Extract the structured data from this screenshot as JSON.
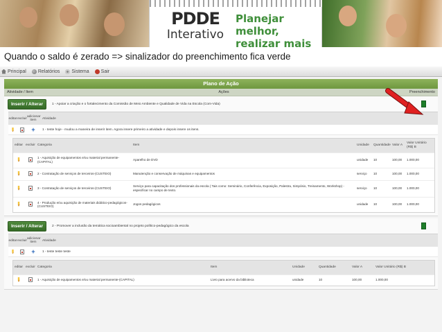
{
  "banner": {
    "logo_title": "PDDE",
    "logo_subtitle": "Interativo",
    "tagline_line1": "Planejar melhor,",
    "tagline_line2": "realizar mais"
  },
  "caption": "Quando o saldo é zerado => sinalizador do preenchimento fica verde",
  "menu": [
    {
      "label": "Principal",
      "icon": "home-icon"
    },
    {
      "label": "Relatórios",
      "icon": "reports-icon"
    },
    {
      "label": "Sistema",
      "icon": "system-icon"
    },
    {
      "label": "Sair",
      "icon": "exit-icon"
    }
  ],
  "plan": {
    "title": "Plano de Ação",
    "columns": {
      "item": "Atividade / Item",
      "actions": "Ações",
      "fill": "Preenchimento"
    },
    "indicator_color": "#1e7e2a",
    "insert_label": "Inserir / Alterar",
    "activity_headers": {
      "edit": "editar",
      "delete": "excluir",
      "add": "adicionar item",
      "activity": "Atividade"
    },
    "item_headers": {
      "edit": "editar",
      "delete": "excluir",
      "category": "Categoria",
      "item": "Item",
      "unit": "Unidade",
      "qty": "Quantidade",
      "value": "Valor A",
      "unit_value": "Valor Unitário (R$) B"
    },
    "actions": [
      {
        "text": "1 - Apoiar a criação e o fortalecimento da Comissão de Meio Ambiente e Qualidade de Vida na Escola (Com-Vida)",
        "activity": "1 - teste hoje - mudou a maneira de inserir item. Agora insere primeiro a atividade e depois insere os itens.",
        "items": [
          {
            "category": "1 - Aquisição de equipamentos e/ou material permanente-(CAPITAL)",
            "item": "Aparelho de DVD",
            "unit": "unidade",
            "qty": "10",
            "value": "100,00",
            "unit_value": "1.000,00"
          },
          {
            "category": "2 - Contratação de serviços de terceiros-(CUSTEIO)",
            "item": "Manutenção e conservação de máquinas e equipamentos",
            "unit": "serviço",
            "qty": "10",
            "value": "100,00",
            "unit_value": "1.000,00"
          },
          {
            "category": "3 - Contratação de serviços de terceiros-(CUSTEIO)",
            "item": "Serviço para capacitação dos professionais da escola ( Tais como: Seminário, Conferência, Exposição, Palestra, Simpósio, Treinamento, Workshop) - especificar no campo de texto.",
            "unit": "serviço",
            "qty": "10",
            "value": "100,00",
            "unit_value": "1.000,00"
          },
          {
            "category": "4 - Produção e/ou aquisição de materiais didático-pedagógicos-(CUSTEIO)",
            "item": "Jogos pedagógicos",
            "unit": "unidade",
            "qty": "10",
            "value": "100,00",
            "unit_value": "1.000,00"
          }
        ]
      },
      {
        "text": "2 - Promover a inclusão da temática socioambiental no projeto político-pedagógico da escola",
        "activity": "1 - teste teste teste",
        "items": [
          {
            "category": "1 - Aquisição de equipamentos e/ou material permanente-(CAPITAL)",
            "item": "Livro para acervo da biblioteca",
            "unit": "unidade",
            "qty": "10",
            "value": "100,00",
            "unit_value": "1.000,00"
          }
        ]
      }
    ]
  },
  "annotation": {
    "arrow_color": "#e02020"
  }
}
